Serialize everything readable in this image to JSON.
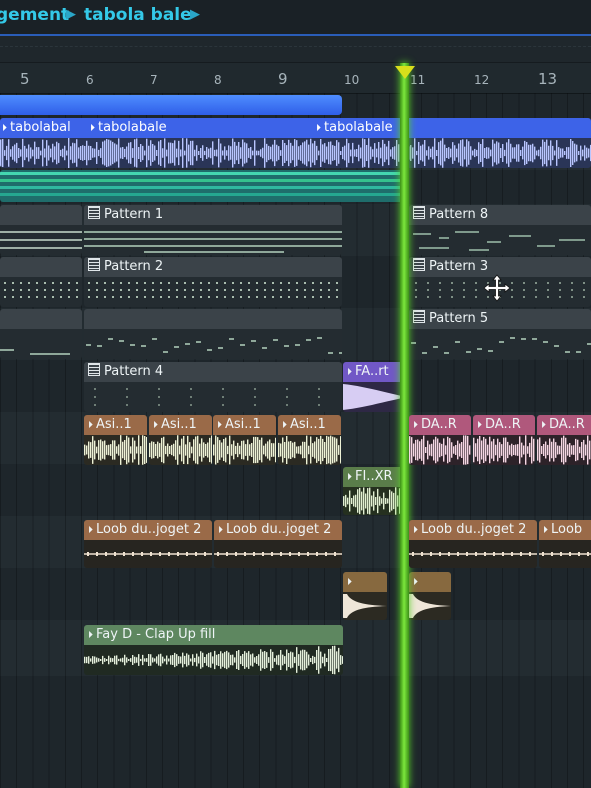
{
  "breadcrumb": {
    "items": [
      "gement",
      "tabola bale"
    ]
  },
  "ruler": {
    "bars": [
      "5",
      "6",
      "7",
      "8",
      "9",
      "10",
      "11",
      "12",
      "13"
    ]
  },
  "tracks": {
    "audio_main": {
      "clips": [
        "tabolabal",
        "tabolabale",
        "tabolabale"
      ]
    },
    "pattern_rows": [
      {
        "clips": [
          "Pattern 1",
          "Pattern 8"
        ]
      },
      {
        "clips": [
          "Pattern 2",
          "Pattern 3"
        ]
      },
      {
        "clips": [
          "Pattern 5"
        ]
      },
      {
        "clips": [
          "Pattern 4",
          "FA..rt"
        ]
      }
    ],
    "asi_row": {
      "clips": [
        "Asi..1",
        "Asi..1",
        "Asi..1",
        "Asi..1",
        "DA..R",
        "DA..R",
        "DA..R"
      ]
    },
    "fi_row": {
      "clips": [
        "FI..XR"
      ]
    },
    "loob_row": {
      "clips": [
        "Loob du..joget 2",
        "Loob du..joget 2",
        "Loob du..joget 2",
        "Loob"
      ]
    },
    "clap_row": {
      "clips": [
        "Fay D - Clap Up fill"
      ]
    }
  },
  "colors": {
    "accent": "#34c9e8",
    "playhead": "#6fe033",
    "loop_bar": "#3f74f5"
  }
}
